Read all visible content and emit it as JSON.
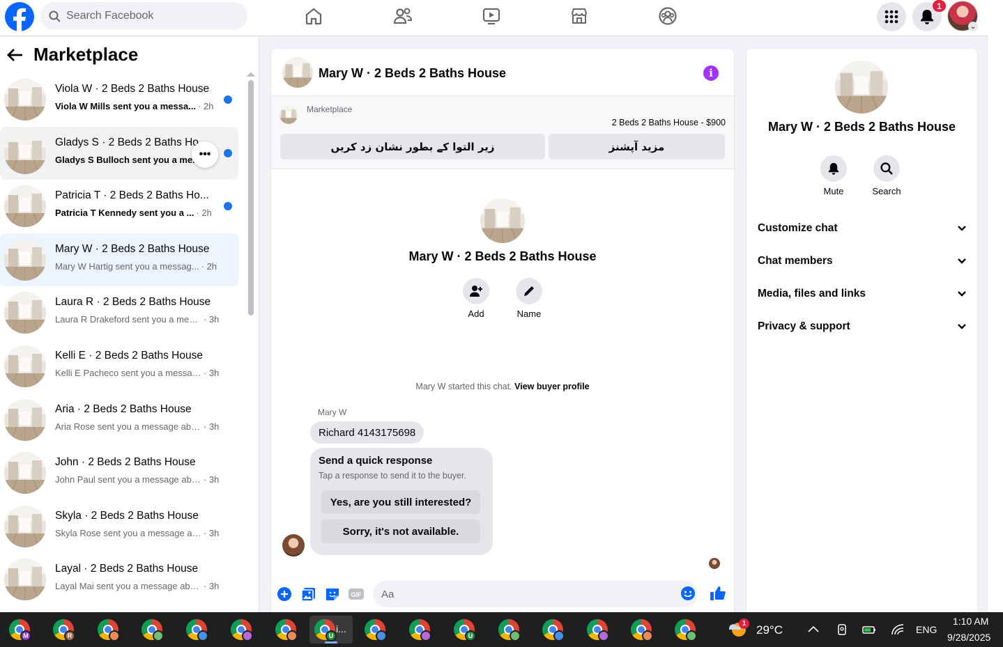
{
  "topbar": {
    "search_placeholder": "Search Facebook",
    "notification_count": "1"
  },
  "sidebar": {
    "title": "Marketplace",
    "conversations": [
      {
        "title": "Viola W · 2 Beds 2 Baths House",
        "preview": "Viola W Mills sent you a messa...",
        "time": "· 2h",
        "unread": true
      },
      {
        "title": "Gladys S · 2 Beds 2 Baths House",
        "preview": "Gladys S Bulloch sent you a me...",
        "time": "",
        "unread": true
      },
      {
        "title": "Patricia T · 2 Beds 2 Baths Ho...",
        "preview": "Patricia T Kennedy sent you a ...",
        "time": "· 2h",
        "unread": true
      },
      {
        "title": "Mary W · 2 Beds 2 Baths House",
        "preview": "Mary W Hartig sent you a messag...",
        "time": "· 2h",
        "unread": false
      },
      {
        "title": "Laura R · 2 Beds 2 Baths House",
        "preview": "Laura R Drakeford sent you a mess...",
        "time": "· 3h",
        "unread": false
      },
      {
        "title": "Kelli E · 2 Beds 2 Baths House",
        "preview": "Kelli E Pacheco sent you a messag...",
        "time": "· 3h",
        "unread": false
      },
      {
        "title": "Aria · 2 Beds 2 Baths House",
        "preview": "Aria Rose sent you a message abo...",
        "time": "· 3h",
        "unread": false
      },
      {
        "title": "John · 2 Beds 2 Baths House",
        "preview": "John Paul sent you a message abo...",
        "time": "· 3h",
        "unread": false
      },
      {
        "title": "Skyla · 2 Beds 2 Baths House",
        "preview": "Skyla Rose sent you a message ab...",
        "time": "· 3h",
        "unread": false
      },
      {
        "title": "Layal · 2 Beds 2 Baths House",
        "preview": "Layal Mai sent you a message abo...",
        "time": "· 3h",
        "unread": false
      }
    ],
    "more_label": "•••"
  },
  "chat": {
    "title": "Mary W · 2 Beds 2 Baths House",
    "info_label": "i",
    "marketplace_label": "Marketplace",
    "listing_price": "2 Beds 2 Baths House - $900",
    "mark_pending_button": "زیر التوا کے بطور نشان زد کریں",
    "more_options_button": "مزید آپشنز",
    "center_name": "Mary W · 2 Beds 2 Baths House",
    "add_label": "Add",
    "name_label": "Name",
    "started_text": "Mary W started this chat.",
    "view_profile_link": "View buyer profile",
    "sender_name": "Mary W",
    "message_text": "Richard 4143175698",
    "quick_response": {
      "heading": "Send a quick response",
      "subtext": "Tap a response to send it to the buyer.",
      "option1": "Yes, are you still interested?",
      "option2": "Sorry, it's not available."
    },
    "composer_placeholder": "Aa",
    "gif_label": "GIF"
  },
  "right_panel": {
    "name": "Mary W · 2 Beds 2 Baths House",
    "mute_label": "Mute",
    "search_label": "Search",
    "rows": [
      "Customize chat",
      "Chat members",
      "Media, files and links",
      "Privacy & support"
    ]
  },
  "taskbar": {
    "active_app_label": "i...",
    "profile_letters": [
      "M",
      "R",
      "",
      "",
      "",
      "",
      "",
      "U",
      "",
      "",
      "U",
      "",
      "",
      "",
      "",
      ""
    ],
    "weather_temp": "29°C",
    "weather_badge": "1",
    "language": "ENG",
    "time": "1:10 AM",
    "date": "9/28/2025"
  },
  "colors": {
    "facebook_blue": "#0866ff",
    "unread_dot": "#1b74e4",
    "active_row": "#ebf5ff",
    "info_purple": "#a033ff",
    "notification_red": "#e41e3f"
  }
}
